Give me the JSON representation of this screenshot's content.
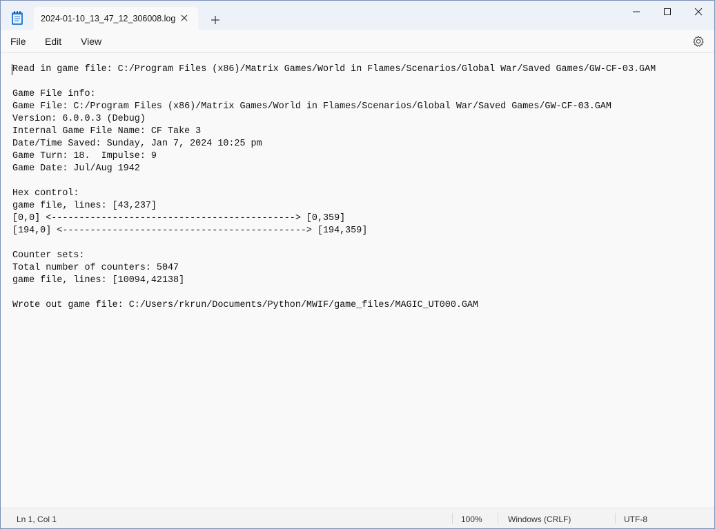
{
  "window": {
    "tab_title": "2024-01-10_13_47_12_306008.log",
    "icons": {
      "app": "notepad-icon",
      "tab_close": "close-icon",
      "new_tab": "plus-icon",
      "minimize": "minimize-icon",
      "maximize": "maximize-icon",
      "close": "close-icon",
      "settings": "gear-icon"
    }
  },
  "menu": {
    "file": "File",
    "edit": "Edit",
    "view": "View"
  },
  "editor": {
    "lines": [
      "Read in game file: C:/Program Files (x86)/Matrix Games/World in Flames/Scenarios/Global War/Saved Games/GW-CF-03.GAM",
      "",
      "Game File info:",
      "Game File: C:/Program Files (x86)/Matrix Games/World in Flames/Scenarios/Global War/Saved Games/GW-CF-03.GAM",
      "Version: 6.0.0.3 (Debug)",
      "Internal Game File Name: CF Take 3",
      "Date/Time Saved: Sunday, Jan 7, 2024 10:25 pm",
      "Game Turn: 18.  Impulse: 9",
      "Game Date: Jul/Aug 1942",
      "",
      "Hex control:",
      "game file, lines: [43,237]",
      "[0,0] <--------------------------------------------> [0,359]",
      "[194,0] <--------------------------------------------> [194,359]",
      "",
      "Counter sets:",
      "Total number of counters: 5047",
      "game file, lines: [10094,42138]",
      "",
      "Wrote out game file: C:/Users/rkrun/Documents/Python/MWIF/game_files/MAGIC_UT000.GAM"
    ]
  },
  "status": {
    "position": "Ln 1, Col 1",
    "zoom": "100%",
    "line_ending": "Windows (CRLF)",
    "encoding": "UTF-8"
  }
}
